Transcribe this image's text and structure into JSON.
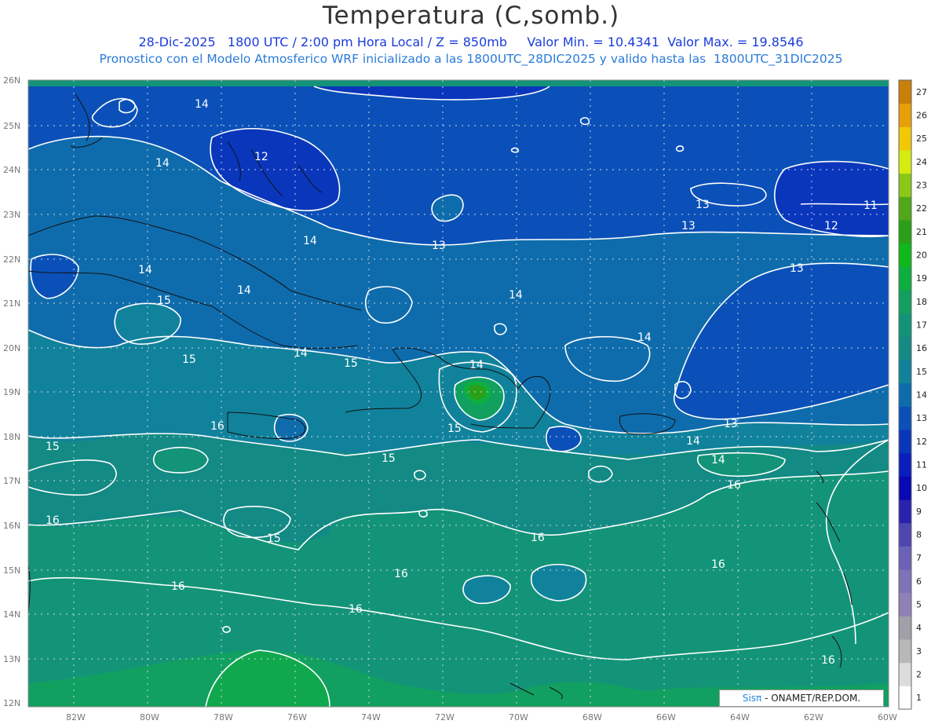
{
  "title": "Temperatura (C,somb.)",
  "subtitle_line1": "28-Dic-2025   1800 UTC / 2:00 pm Hora Local / Z = 850mb     Valor Min. = 10.4341  Valor Max. = 19.8546",
  "subtitle_line2": "Pronostico con el Modelo Atmosferico WRF inicializado a las 1800UTC_28DIC2025 y valido hasta las  1800UTC_31DIC2025",
  "credit": {
    "brand": "Sisπ",
    "text": " - ONAMET/REP.DOM."
  },
  "lat_labels": [
    "26N",
    "25N",
    "24N",
    "23N",
    "22N",
    "21N",
    "20N",
    "19N",
    "18N",
    "17N",
    "16N",
    "15N",
    "14N",
    "13N",
    "12N"
  ],
  "lon_labels": [
    "82W",
    "80W",
    "78W",
    "76W",
    "74W",
    "72W",
    "70W",
    "68W",
    "66W",
    "64W",
    "62W",
    "60W"
  ],
  "colorbar": {
    "labels": [
      "1",
      "2",
      "3",
      "4",
      "5",
      "6",
      "7",
      "8",
      "9",
      "10",
      "11",
      "12",
      "13",
      "14",
      "15",
      "16",
      "17",
      "18",
      "19",
      "20",
      "21",
      "22",
      "23",
      "24",
      "25",
      "26",
      "27"
    ],
    "colors": [
      "#ffffff",
      "#dcdcdc",
      "#b8b8b8",
      "#a0a0a8",
      "#9080b8",
      "#7f72b8",
      "#6a62b6",
      "#4d46b0",
      "#2a22ae",
      "#0808b4",
      "#0a1ec0",
      "#0a36bc",
      "#0a50b8",
      "#0e6cac",
      "#11829c",
      "#138a84",
      "#139478",
      "#11a060",
      "#0fae40",
      "#10b81c",
      "#2aa018",
      "#50a818",
      "#8ac818",
      "#d4ec10",
      "#f0c808",
      "#e8a008",
      "#c88008"
    ]
  },
  "contour_labels": [
    "14",
    "14",
    "12",
    "14",
    "14",
    "13",
    "14",
    "14",
    "15",
    "15",
    "14",
    "15",
    "14",
    "13",
    "13",
    "12",
    "11",
    "13",
    "14",
    "14",
    "16",
    "15",
    "15",
    "15",
    "14",
    "13",
    "16",
    "15",
    "16",
    "16",
    "16",
    "16",
    "16",
    "16",
    "16"
  ],
  "map_extent": {
    "lon_min": -83.3,
    "lon_max": -60.0,
    "lat_min": 11.9,
    "lat_max": 26.1
  }
}
